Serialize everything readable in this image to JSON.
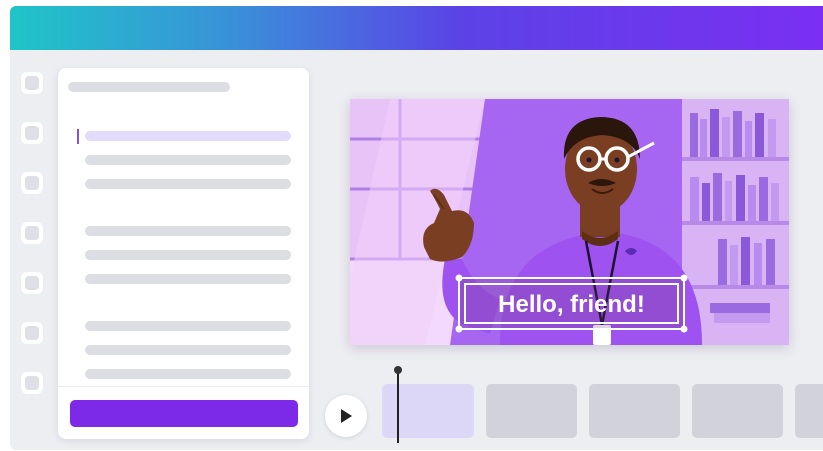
{
  "editor": {
    "caption_text": "Hello, friend!",
    "accent_color": "#7d2ae8",
    "header_gradient": [
      "#1fc5c8",
      "#5b43e6",
      "#7a2ff2"
    ]
  },
  "icons": {
    "play": "play-icon"
  }
}
